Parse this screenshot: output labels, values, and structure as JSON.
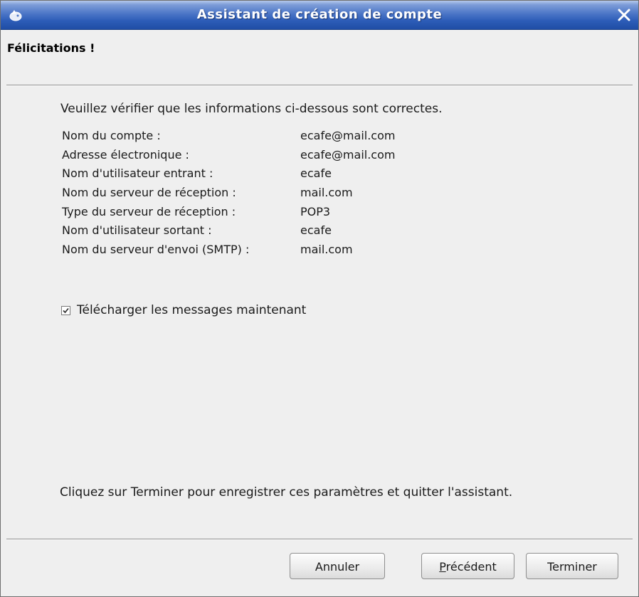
{
  "window": {
    "title": "Assistant de création de compte"
  },
  "header": {
    "title": "Félicitations !"
  },
  "intro": "Veuillez vérifier que les informations ci-dessous sont correctes.",
  "account_info": [
    {
      "label": "Nom du compte :",
      "value": "ecafe@mail.com"
    },
    {
      "label": "Adresse électronique :",
      "value": "ecafe@mail.com"
    },
    {
      "label": "Nom d'utilisateur entrant :",
      "value": "ecafe"
    },
    {
      "label": "Nom du serveur de réception :",
      "value": "mail.com"
    },
    {
      "label": "Type du serveur de réception :",
      "value": "POP3"
    },
    {
      "label": "Nom d'utilisateur sortant :",
      "value": "ecafe"
    },
    {
      "label": "Nom du serveur d'envoi (SMTP) :",
      "value": "mail.com"
    }
  ],
  "download": {
    "label": "Télécharger les messages maintenant",
    "checked": true
  },
  "finish_note": "Cliquez sur Terminer pour enregistrer ces paramètres et quitter l'assistant.",
  "buttons": {
    "cancel": "Annuler",
    "previous_mnemonic": "P",
    "previous_rest": "récédent",
    "finish": "Terminer"
  },
  "icons": {
    "window": "app-icon",
    "close": "close-icon",
    "checkbox": "checkmark-icon"
  },
  "colors": {
    "titlebar": "#2d5db8",
    "background": "#efefef"
  }
}
